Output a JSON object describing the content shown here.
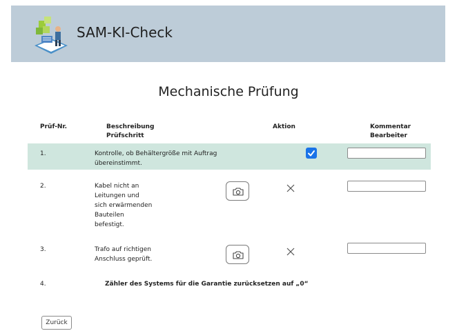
{
  "app": {
    "title": "SAM-KI-Check"
  },
  "page": {
    "title": "Mechanische Prüfung"
  },
  "table": {
    "headers": {
      "nr": "Prüf-Nr.",
      "desc_line1": "Beschreibung",
      "desc_line2": "Prüfschritt",
      "action": "Aktion",
      "comment_line1": "Kommentar",
      "comment_line2": "Bearbeiter"
    },
    "rows": [
      {
        "nr": "1.",
        "desc": [
          "Kontrolle, ob Behältergröße mit Auftrag",
          "übereinstimmt."
        ],
        "action": "checked",
        "comment": ""
      },
      {
        "nr": "2.",
        "desc": [
          "Kabel nicht an",
          "Leitungen und",
          "sich erwärmenden",
          "Bauteilen",
          "befestigt."
        ],
        "action": "camera",
        "comment": ""
      },
      {
        "nr": "3.",
        "desc": [
          "Trafo auf richtigen",
          "Anschluss geprüft."
        ],
        "action": "camera",
        "comment": ""
      },
      {
        "nr": "4.",
        "desc": [
          "Zähler des Systems für die Garantie zurücksetzen auf „0“"
        ],
        "action": ""
      }
    ]
  },
  "footer": {
    "back_label": "Zurück"
  },
  "colors": {
    "header_bg": "#bdccd8",
    "row_highlight": "#cfe6de",
    "checkbox": "#1a73e8"
  }
}
